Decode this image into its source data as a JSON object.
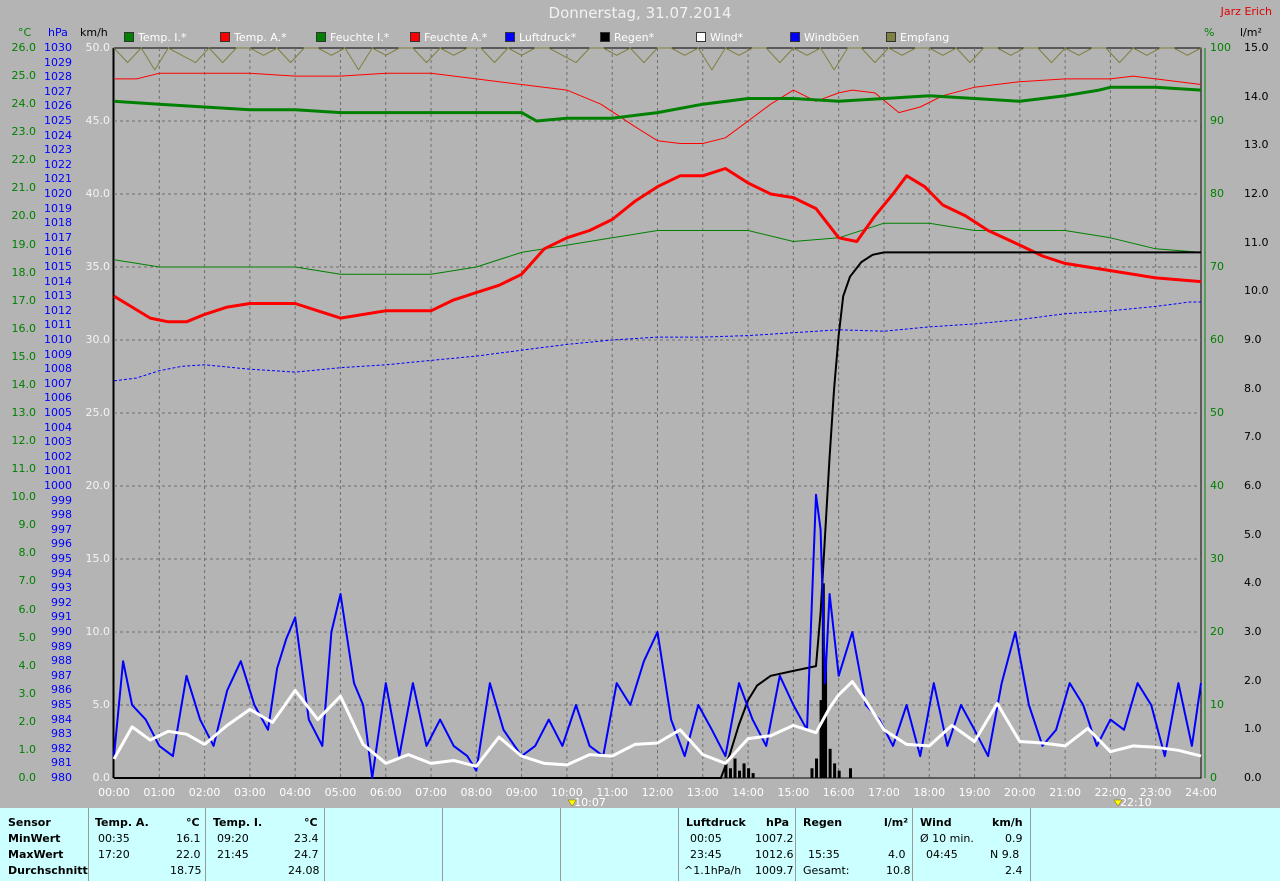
{
  "title": "Donnerstag, 31.07.2014",
  "station": "Jarz Erich",
  "units": {
    "temp": "°C",
    "press": "hPa",
    "wind": "km/h",
    "hum": "%",
    "rain": "l/m²"
  },
  "legend": [
    {
      "label": "Temp. I.*",
      "color": "#008000"
    },
    {
      "label": "Temp. A.*",
      "color": "#ff0000"
    },
    {
      "label": "Feuchte I.*",
      "color": "#008000"
    },
    {
      "label": "Feuchte A.*",
      "color": "#ff0000"
    },
    {
      "label": "Luftdruck*",
      "color": "#0000ff"
    },
    {
      "label": "Regen*",
      "color": "#000000"
    },
    {
      "label": "Wind*",
      "color": "#ffffff"
    },
    {
      "label": "Windböen",
      "color": "#0000ff"
    },
    {
      "label": "Empfang",
      "color": "#808040"
    }
  ],
  "axes": {
    "temp_ticks": [
      "26.0",
      "25.0",
      "24.0",
      "23.0",
      "22.0",
      "21.0",
      "20.0",
      "19.0",
      "18.0",
      "17.0",
      "16.0",
      "15.0",
      "14.0",
      "13.0",
      "12.0",
      "11.0",
      "10.0",
      "9.0",
      "8.0",
      "7.0",
      "6.0",
      "5.0",
      "4.0",
      "3.0",
      "2.0",
      "1.0",
      "0.0"
    ],
    "pressure_ticks": [
      "1030",
      "1029",
      "1028",
      "1027",
      "1026",
      "1025",
      "1024",
      "1023",
      "1022",
      "1021",
      "1020",
      "1019",
      "1018",
      "1017",
      "1016",
      "1015",
      "1014",
      "1013",
      "1012",
      "1011",
      "1010",
      "1009",
      "1008",
      "1007",
      "1006",
      "1005",
      "1004",
      "1003",
      "1002",
      "1001",
      "1000",
      "999",
      "998",
      "997",
      "996",
      "995",
      "994",
      "993",
      "992",
      "991",
      "990",
      "989",
      "988",
      "987",
      "986",
      "985",
      "984",
      "983",
      "982",
      "981",
      "980"
    ],
    "wind_ticks": [
      "50.0",
      "45.0",
      "40.0",
      "35.0",
      "30.0",
      "25.0",
      "20.0",
      "15.0",
      "10.0",
      "5.0",
      "0.0"
    ],
    "humidity_ticks": [
      "100",
      "90",
      "80",
      "70",
      "60",
      "50",
      "40",
      "30",
      "20",
      "10",
      "0"
    ],
    "rain_ticks": [
      "15.0",
      "14.0",
      "13.0",
      "12.0",
      "11.0",
      "10.0",
      "9.0",
      "8.0",
      "7.0",
      "6.0",
      "5.0",
      "4.0",
      "3.0",
      "2.0",
      "1.0",
      "0.0"
    ],
    "time_ticks": [
      "00:00",
      "01:00",
      "02:00",
      "03:00",
      "04:00",
      "05:00",
      "06:00",
      "07:00",
      "08:00",
      "09:00",
      "10:00",
      "11:00",
      "12:00",
      "13:00",
      "14:00",
      "15:00",
      "16:00",
      "17:00",
      "18:00",
      "19:00",
      "20:00",
      "21:00",
      "22:00",
      "23:00",
      "24:00"
    ],
    "sunrise": "10:07",
    "sunset": "22:10"
  },
  "chart_data": {
    "type": "line",
    "x_unit": "hours",
    "grid": true,
    "series": [
      {
        "name": "Temp. I.*",
        "color": "#008000",
        "axis": "temp",
        "width": 3,
        "x": [
          0,
          1,
          2,
          3,
          4,
          5,
          6,
          7,
          8,
          9,
          9.33,
          10,
          11,
          12,
          13,
          14,
          15,
          16,
          17,
          18,
          19,
          20,
          21,
          21.75,
          22,
          23,
          24
        ],
        "y": [
          24.1,
          24.0,
          23.9,
          23.8,
          23.8,
          23.7,
          23.7,
          23.7,
          23.7,
          23.7,
          23.4,
          23.5,
          23.5,
          23.7,
          24.0,
          24.2,
          24.2,
          24.1,
          24.2,
          24.3,
          24.2,
          24.1,
          24.3,
          24.5,
          24.6,
          24.6,
          24.5
        ]
      },
      {
        "name": "Temp. A.*",
        "color": "#ff0000",
        "axis": "temp",
        "width": 1,
        "x": [
          0,
          0.5,
          1,
          2,
          3,
          4,
          5,
          6,
          7,
          8,
          9,
          10,
          10.75,
          11.5,
          12,
          12.5,
          13,
          13.5,
          14,
          14.5,
          15,
          15.5,
          16,
          16.3,
          16.8,
          17.33,
          17.8,
          18.3,
          19,
          20,
          21,
          22,
          22.5,
          23,
          24
        ],
        "y": [
          24.9,
          24.9,
          25.1,
          25.1,
          25.1,
          25.0,
          25.0,
          25.1,
          25.1,
          24.9,
          24.7,
          24.5,
          24.0,
          23.2,
          22.7,
          22.6,
          22.6,
          22.8,
          23.4,
          24.0,
          24.5,
          24.1,
          24.4,
          24.5,
          24.4,
          23.7,
          23.9,
          24.3,
          24.6,
          24.8,
          24.9,
          24.9,
          25.0,
          24.9,
          24.7
        ]
      },
      {
        "name": "Feuchte I.*",
        "color": "#008000",
        "axis": "humidity",
        "width": 1,
        "x": [
          0,
          1,
          2,
          3,
          4,
          5,
          6,
          7,
          8,
          9,
          10,
          11,
          12,
          13,
          14,
          15,
          16,
          17,
          18,
          19,
          20,
          21,
          22,
          23,
          24
        ],
        "y": [
          71,
          70,
          70,
          70,
          70,
          69,
          69,
          69,
          70,
          72,
          73,
          74,
          75,
          75,
          75,
          73.5,
          74,
          76,
          76,
          75,
          75,
          75,
          74,
          72.5,
          72
        ]
      },
      {
        "name": "Feuchte A.*",
        "color": "#ff0000",
        "axis": "humidity",
        "width": 3,
        "x": [
          0,
          0.4,
          0.8,
          1.2,
          1.6,
          2,
          2.5,
          3,
          4,
          4.5,
          5,
          6,
          7,
          7.5,
          8,
          8.5,
          9,
          9.5,
          10,
          10.5,
          11,
          11.5,
          12,
          12.5,
          13,
          13.5,
          14,
          14.5,
          15,
          15.5,
          16,
          16.4,
          16.8,
          17.2,
          17.5,
          17.9,
          18.3,
          18.8,
          19.3,
          20,
          20.5,
          21,
          22,
          23,
          24
        ],
        "y": [
          66,
          64.5,
          63,
          62.5,
          62.5,
          63.5,
          64.5,
          65,
          65,
          64,
          63,
          64,
          64,
          65.5,
          66.5,
          67.5,
          69,
          72.5,
          74,
          75,
          76.5,
          79,
          81,
          82.5,
          82.5,
          83.5,
          81.5,
          80,
          79.5,
          78,
          74,
          73.5,
          77,
          80,
          82.5,
          81,
          78.5,
          77,
          75,
          73,
          71.5,
          70.5,
          69.5,
          68.5,
          68
        ]
      },
      {
        "name": "Luftdruck*",
        "color": "#0000ff",
        "axis": "pressure",
        "width": 1,
        "dash": true,
        "x": [
          0,
          0.5,
          1,
          1.5,
          2,
          3,
          4,
          5,
          6,
          7,
          8,
          9,
          10,
          11,
          12,
          13,
          14,
          15,
          16,
          17,
          18,
          19,
          20,
          21,
          22,
          23,
          23.75,
          24
        ],
        "y": [
          1007.2,
          1007.4,
          1007.9,
          1008.2,
          1008.3,
          1008.0,
          1007.8,
          1008.1,
          1008.3,
          1008.6,
          1008.9,
          1009.3,
          1009.7,
          1010.0,
          1010.2,
          1010.2,
          1010.3,
          1010.5,
          1010.7,
          1010.6,
          1010.9,
          1011.1,
          1011.4,
          1011.8,
          1012.0,
          1012.3,
          1012.6,
          1012.6
        ]
      },
      {
        "name": "Regen*",
        "color": "#000000",
        "axis": "rain",
        "width": 2,
        "x": [
          0,
          13.4,
          13.6,
          13.8,
          14,
          14.2,
          14.5,
          15,
          15.5,
          15.6,
          15.7,
          15.8,
          15.9,
          16,
          16.1,
          16.25,
          16.5,
          16.75,
          17,
          18,
          19,
          24
        ],
        "y": [
          0,
          0,
          0.5,
          1.1,
          1.6,
          1.9,
          2.1,
          2.2,
          2.3,
          3.4,
          5.0,
          6.6,
          8.0,
          9.1,
          9.9,
          10.3,
          10.6,
          10.75,
          10.8,
          10.8,
          10.8,
          10.8
        ]
      },
      {
        "name": "Wind*",
        "color": "#ffffff",
        "axis": "wind",
        "width": 3,
        "x": [
          0,
          0.4,
          0.8,
          1.2,
          1.6,
          2,
          2.5,
          3,
          3.5,
          4,
          4.5,
          5,
          5.5,
          6,
          6.5,
          7,
          7.5,
          8,
          8.5,
          9,
          9.5,
          10,
          10.5,
          11,
          11.5,
          12,
          12.5,
          13,
          13.5,
          14,
          14.5,
          15,
          15.5,
          15.8,
          16,
          16.3,
          16.6,
          17,
          17.5,
          18,
          18.5,
          19,
          19.5,
          20,
          20.5,
          21,
          21.5,
          22,
          22.5,
          23,
          23.5,
          24
        ],
        "y": [
          1.3,
          3.5,
          2.6,
          3.2,
          3.0,
          2.3,
          3.6,
          4.7,
          3.8,
          6.0,
          4.0,
          5.6,
          2.3,
          1.0,
          1.6,
          1.0,
          1.2,
          0.8,
          2.8,
          1.5,
          1.0,
          0.9,
          1.6,
          1.5,
          2.3,
          2.4,
          3.3,
          1.6,
          1.0,
          2.7,
          2.9,
          3.6,
          3.1,
          4.8,
          5.7,
          6.6,
          5.3,
          3.3,
          2.3,
          2.2,
          3.6,
          2.5,
          5.1,
          2.5,
          2.4,
          2.2,
          3.4,
          1.8,
          2.2,
          2.1,
          1.9,
          1.5
        ]
      },
      {
        "name": "Windböen",
        "color": "#0000ff",
        "axis": "wind",
        "width": 2,
        "x": [
          0,
          0.2,
          0.4,
          0.7,
          1,
          1.3,
          1.6,
          1.9,
          2.2,
          2.5,
          2.8,
          3.1,
          3.4,
          3.6,
          3.8,
          4,
          4.3,
          4.6,
          4.8,
          5,
          5.3,
          5.5,
          5.7,
          6,
          6.3,
          6.6,
          6.9,
          7.2,
          7.5,
          7.8,
          8,
          8.3,
          8.6,
          9,
          9.3,
          9.6,
          9.9,
          10.2,
          10.5,
          10.8,
          11.1,
          11.4,
          11.7,
          12,
          12.3,
          12.6,
          12.9,
          13.2,
          13.5,
          13.8,
          14.1,
          14.4,
          14.7,
          15,
          15.3,
          15.5,
          15.6,
          15.7,
          15.8,
          16,
          16.3,
          16.6,
          16.9,
          17.2,
          17.5,
          17.8,
          18.1,
          18.4,
          18.7,
          19,
          19.3,
          19.6,
          19.9,
          20.2,
          20.5,
          20.8,
          21.1,
          21.4,
          21.7,
          22,
          22.3,
          22.6,
          22.9,
          23.2,
          23.5,
          23.8,
          24
        ],
        "y": [
          1.5,
          8,
          5,
          4,
          2.2,
          1.5,
          7,
          4,
          2.2,
          6,
          8,
          5,
          3.3,
          7.5,
          9.5,
          11,
          4,
          2.2,
          10,
          12.6,
          6.5,
          5,
          0,
          6.5,
          1.5,
          6.5,
          2.2,
          4,
          2.2,
          1.5,
          0.5,
          6.5,
          3.3,
          1.5,
          2.2,
          4,
          2.2,
          5,
          2.2,
          1.5,
          6.5,
          5,
          8,
          10,
          4,
          1.5,
          5,
          3.3,
          1.5,
          6.5,
          4,
          2.2,
          7,
          5,
          3.3,
          19.4,
          17,
          6.5,
          12.6,
          7,
          10,
          5,
          4,
          2.2,
          5,
          1.5,
          6.5,
          2.2,
          5,
          3.3,
          1.5,
          6.5,
          10,
          5,
          2.2,
          3.3,
          6.5,
          5,
          2.2,
          4,
          3.3,
          6.5,
          5,
          1.5,
          6.5,
          2.2,
          6.5
        ]
      },
      {
        "name": "Empfang",
        "color": "#808040",
        "axis": "humidity",
        "width": 1,
        "x": [
          0,
          0.3,
          0.6,
          0.9,
          1.2,
          1.5,
          1.8,
          2.1,
          2.4,
          2.7,
          3,
          3.3,
          3.6,
          3.9,
          4.2,
          4.5,
          4.8,
          5.1,
          5.4,
          5.7,
          6,
          6.3,
          6.6,
          6.9,
          7.2,
          7.5,
          7.8,
          8.1,
          8.4,
          8.7,
          9,
          9.3,
          9.6,
          9.9,
          10.2,
          10.5,
          10.8,
          11.1,
          11.4,
          11.7,
          12,
          12.3,
          12.6,
          12.9,
          13.2,
          13.5,
          13.8,
          14.1,
          14.4,
          14.7,
          15,
          15.3,
          15.6,
          15.9,
          16.2,
          16.5,
          16.8,
          17.1,
          17.4,
          17.7,
          18,
          18.3,
          18.6,
          18.9,
          19.2,
          19.5,
          19.8,
          20.1,
          20.4,
          20.7,
          21,
          21.3,
          21.6,
          21.9,
          22.2,
          22.5,
          22.8,
          23.1,
          23.4,
          23.7,
          24
        ],
        "y": [
          100,
          98,
          100,
          97,
          100,
          99,
          98,
          100,
          98,
          100,
          100,
          99,
          100,
          98,
          100,
          100,
          99,
          100,
          97,
          100,
          99,
          100,
          100,
          98,
          100,
          99,
          100,
          100,
          98,
          100,
          99,
          100,
          100,
          99,
          98,
          100,
          100,
          99,
          100,
          98,
          100,
          100,
          99,
          100,
          97,
          100,
          99,
          100,
          100,
          98,
          100,
          99,
          100,
          97,
          100,
          100,
          98,
          100,
          99,
          100,
          100,
          99,
          100,
          98,
          100,
          100,
          99,
          100,
          100,
          98,
          100,
          99,
          100,
          100,
          98,
          100,
          99,
          100,
          100,
          99,
          100
        ]
      }
    ],
    "rain_bars": {
      "color": "#000000",
      "x": [
        13.5,
        13.6,
        13.7,
        13.8,
        13.9,
        14.0,
        14.1,
        15.4,
        15.5,
        15.6,
        15.65,
        15.7,
        15.8,
        15.9,
        16.0,
        16.25
      ],
      "y": [
        0.3,
        0.2,
        0.4,
        0.15,
        0.3,
        0.2,
        0.1,
        0.2,
        0.4,
        1.6,
        4.0,
        2.4,
        0.6,
        0.3,
        0.15,
        0.2
      ]
    }
  },
  "summary": {
    "row_labels": [
      "Sensor",
      "MinWert",
      "MaxWert",
      "Durchschnitt"
    ],
    "temp_a": {
      "header": "Temp. A.",
      "unit": "°C",
      "min_time": "00:35",
      "min": "16.1",
      "max_time": "17:20",
      "max": "22.0",
      "avg": "18.75"
    },
    "temp_i": {
      "header": "Temp. I.",
      "unit": "°C",
      "min_time": "09:20",
      "min": "23.4",
      "max_time": "21:45",
      "max": "24.7",
      "avg": "24.08"
    },
    "pressure": {
      "header": "Luftdruck",
      "unit": "hPa",
      "min_time": "00:05",
      "min": "1007.2",
      "max_time": "23:45",
      "max": "1012.6",
      "trend": "^1.1hPa/h",
      "avg": "1009.7"
    },
    "rain": {
      "header": "Regen",
      "unit": "l/m²",
      "max_time": "15:35",
      "max": "4.0",
      "total_label": "Gesamt:",
      "total": "10.8"
    },
    "wind": {
      "header": "Wind",
      "unit": "km/h",
      "avg_label": "Ø 10 min.",
      "avg": "0.9",
      "gust_time": "04:45",
      "gust": "N 9.8",
      "mean": "2.4"
    }
  }
}
